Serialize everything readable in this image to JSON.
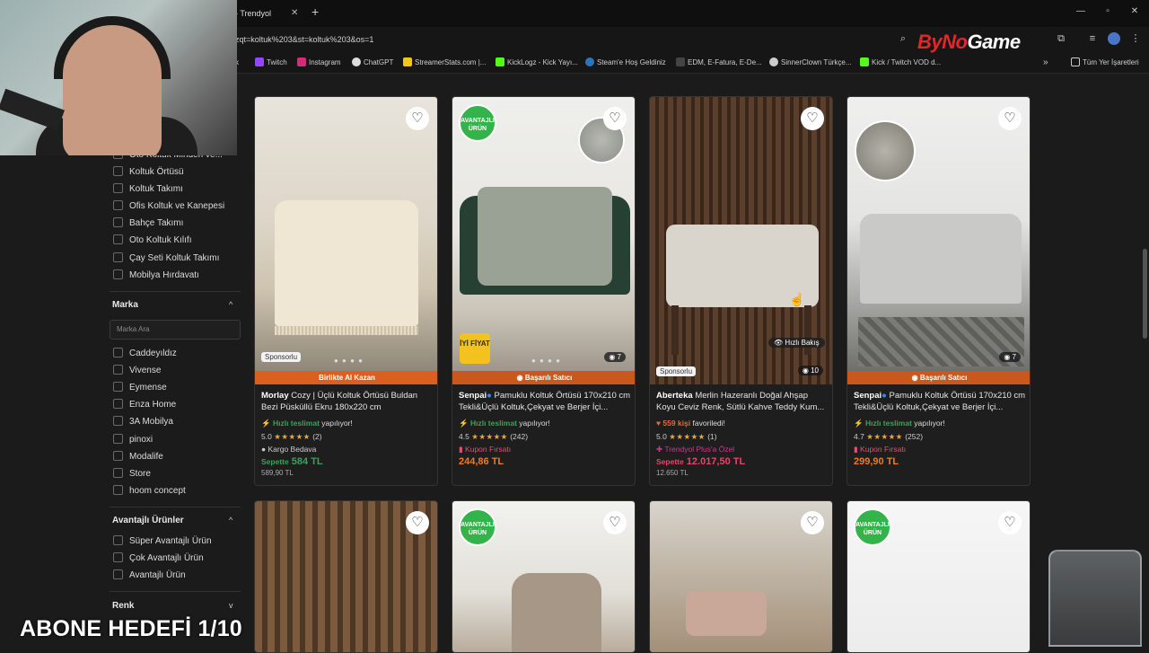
{
  "browser": {
    "tab_title": "- Trendyol",
    "tab_close": "✕",
    "new_tab": "+",
    "url": "zqt=koltuk%203&st=koltuk%203&os=1",
    "bookmarks": [
      {
        "label": "k",
        "color": "#888888"
      },
      {
        "label": "Twitch",
        "color": "#9146ff"
      },
      {
        "label": "Instagram",
        "color": "#d62976"
      },
      {
        "label": "ChatGPT",
        "color": "#dddddd"
      },
      {
        "label": "StreamerStats.com |...",
        "color": "#f2c811"
      },
      {
        "label": "KickLogz - Kick Yayı...",
        "color": "#53fc18"
      },
      {
        "label": "Steam'e Hoş Geldiniz",
        "color": "#2a75bb"
      },
      {
        "label": "EDM, E-Fatura, E-De...",
        "color": "#444444"
      },
      {
        "label": "SinnerClown Türkçe...",
        "color": "#cccccc"
      },
      {
        "label": "Kick / Twitch VOD d...",
        "color": "#53fc18"
      }
    ],
    "bookmarks_more": "»",
    "all_bookmarks": "Tüm Yer İşaretleri"
  },
  "overlay": {
    "logo_prefix": "ByNo",
    "logo_suffix": "Game",
    "goal_text": "ABONE HEDEFİ 1/10"
  },
  "sidebar": {
    "category_items": [
      "Oto Koltuk Minderi ve...",
      "Koltuk Örtüsü",
      "Koltuk Takımı",
      "Ofis Koltuk ve Kanepesi",
      "Bahçe Takımı",
      "Oto Koltuk Kılıfı",
      "Çay Seti Koltuk Takımı",
      "Mobilya Hırdavatı"
    ],
    "brand_title": "Marka",
    "brand_search_placeholder": "Marka Ara",
    "brands": [
      "Caddeyıldız",
      "Vivense",
      "Eymense",
      "Enza Home",
      "3A Mobilya",
      "pinoxi",
      "Modalife",
      "Store",
      "hoom concept"
    ],
    "advantage_title": "Avantajlı Ürünler",
    "advantage_items": [
      "Süper Avantajlı Ürün",
      "Çok Avantajlı Ürün",
      "Avantajlı Ürün"
    ],
    "color_title": "Renk"
  },
  "products": [
    {
      "brand": "Morlay",
      "name": "Cozy | Üçlü Koltuk Örtüsü Buldan Bezi Püsküllü Ekru 180x220 cm",
      "strip": "Birlikte Al Kazan",
      "sponsor": "Sponsorlu",
      "tag": "Hızlı teslimat",
      "tag_rest": "yapılıyor!",
      "rating": "5.0",
      "review_count": "(2)",
      "extra": "Kargo Bedava",
      "price_prefix": "Sepette",
      "price": "584 TL",
      "old_price": "589,90 TL"
    },
    {
      "brand": "Senpai",
      "name": "Pamuklu Koltuk Örtüsü 170x210 cm Tekli&Üçlü Koltuk,Çekyat ve Berjer İçi...",
      "strip": "Başarılı Satıcı",
      "badge": "AVANTAJLI ÜRÜN",
      "good_price": "İYİ FİYAT",
      "image_count": "7",
      "tag": "Hızlı teslimat",
      "tag_rest": "yapılıyor!",
      "rating": "4.5",
      "review_count": "(242)",
      "extra": "Kupon Fırsatı",
      "price": "244,86 TL"
    },
    {
      "brand": "Aberteka",
      "name": "Merlin Hazeranlı Doğal Ahşap Koyu Ceviz Renk, Sütlü Kahve Teddy Kum...",
      "sponsor": "Sponsorlu",
      "quick_view": "Hızlı Bakış",
      "image_count": "10",
      "fav_count": "559 kişi",
      "fav_rest": "favoriledi!",
      "rating": "5.0",
      "review_count": "(1)",
      "extra": "Trendyol Plus'a Özel",
      "price_prefix": "Sepette",
      "price": "12.017,50 TL",
      "old_price": "12.650 TL"
    },
    {
      "brand": "Senpai",
      "name": "Pamuklu Koltuk Örtüsü 170x210 cm Tekli&Üçlü Koltuk,Çekyat ve Berjer İçi...",
      "strip": "Başarılı Satıcı",
      "image_count": "7",
      "tag": "Hızlı teslimat",
      "tag_rest": "yapılıyor!",
      "rating": "4.7",
      "review_count": "(252)",
      "extra": "Kupon Fırsatı",
      "price": "299,90 TL"
    }
  ],
  "second_row_badges": [
    "AVANTAJLI ÜRÜN",
    "AVANTAJLI ÜRÜN"
  ],
  "icons": {
    "heart": "♡",
    "star": "★★★★★",
    "chevron_up": "^",
    "chevron_down": "v"
  }
}
